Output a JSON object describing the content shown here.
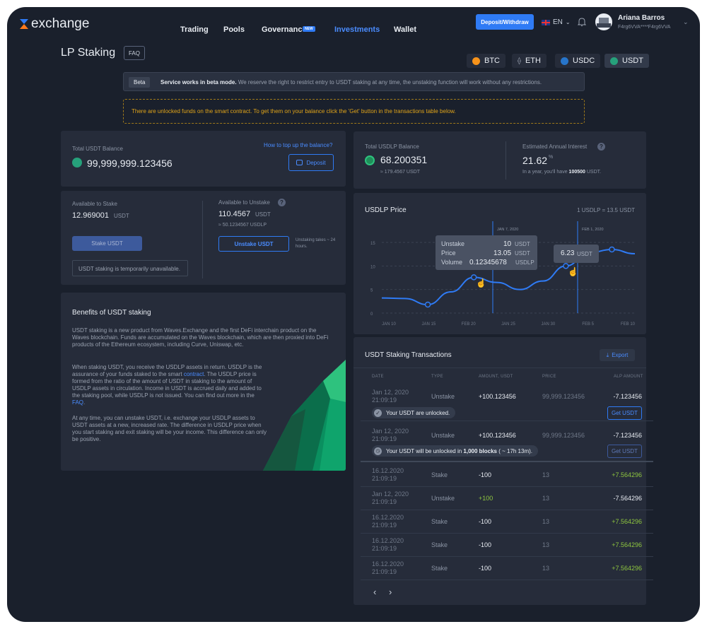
{
  "header": {
    "logo_text": "exchange",
    "nav": [
      "Trading",
      "Pools",
      "Governance",
      "Investments",
      "Wallet"
    ],
    "new_badge": "NEW",
    "deposit_button": "Deposit/Withdraw",
    "lang": "EN",
    "user_name": "Ariana Barros",
    "user_address": "F4rg6VVA****F4rg6VVA",
    "accent": "#2f7bf5"
  },
  "page": {
    "title": "LP Staking",
    "faq": "FAQ",
    "coins": [
      "BTC",
      "ETH",
      "USDC",
      "USDT"
    ],
    "beta_badge": "Beta",
    "beta_bold": "Service works in beta mode.",
    "beta_text": " We reserve the right to restrict entry to USDT staking at any time, the unstaking function will work without any restrictions.",
    "warning": "There are unlocked funds on the smart contract. To get them on your balance click the 'Get' button in the transactions table below."
  },
  "balance": {
    "label": "Total USDT Balance",
    "value": "99,999,999.123456",
    "topup_link": "How to top up the balance?",
    "deposit_button": "Deposit"
  },
  "stake": {
    "available_label": "Available to Stake",
    "available_value": "12.969001",
    "available_unit": "USDT",
    "stake_button": "Stake USDT",
    "unavailable_note": "USDT staking is temporarily unavailable.",
    "unstake_label": "Available to Unstake",
    "unstake_value": "110.4567",
    "unstake_unit": "USDT",
    "unstake_sub": "≈ 50.1234567 USDLP",
    "unstake_button": "Unstake USDT",
    "unstake_note": "Unstaking takes ~ 24 hours."
  },
  "benefits": {
    "title": "Benefits of USDT staking",
    "p1": "USDT staking is a new product from Waves.Exchange and the first DeFi interchain product on the Waves blockchain. Funds are accumulated on the Waves blockchain, which are then proxied into DeFi products of the Ethereum ecosystem, including Curve, Uniswap, etc.",
    "p2a": "When staking USDT, you receive the USDLP assets in return. USDLP is the assurance of your funds staked to the smart ",
    "p2link": "contract",
    "p2b": ". The USDLP price is formed from the ratio of the amount of USDT in staking to the amount of USDLP assets in circulation. Income in USDT is accrued daily and added to the staking pool, while USDLP is not issued. You can find out more in the ",
    "p2faq": "FAQ",
    "p2end": ".",
    "p3": "At any time, you can unstake USDT, i.e. exchange your USDLP assets to USDT assets at a new, increased rate. The difference in USDLP price when you start staking and exit staking will be your income. This difference can only be positive."
  },
  "usdlp": {
    "label": "Total USDLP Balance",
    "value": "68.200351",
    "sub": "≈ 179.4567 USDT",
    "interest_label": "Estimated Annual Interest",
    "interest_value": "21.62",
    "interest_unit": "%",
    "year_prefix": "In a year, you'll have ",
    "year_value": "100500",
    "year_suffix": " USDT."
  },
  "chart_data": {
    "type": "line",
    "title": "USDLP Price",
    "rate": "1 USDLP = 13.5 USDT",
    "xticks": [
      "JAN 10",
      "JAN 15",
      "FEB 20",
      "JAN 25",
      "JAN 30",
      "FEB 5",
      "FEB 10"
    ],
    "yticks": [
      0,
      5,
      10,
      15
    ],
    "ylim": [
      0,
      18
    ],
    "series": [
      {
        "values": [
          3.2,
          3.1,
          1.8,
          4.5,
          7.6,
          6.5,
          5.0,
          6.8,
          10.0,
          12.8,
          13.5,
          12.6
        ]
      }
    ],
    "markers": [
      {
        "label": "JAN 7, 2020"
      },
      {
        "label": "FEB 1, 2020"
      }
    ],
    "tooltip1": {
      "unstake_label": "Unstake",
      "unstake_value": "10",
      "unstake_unit": "USDT",
      "price_label": "Price",
      "price_value": "13.05",
      "price_unit": "USDT",
      "volume_label": "Volume",
      "volume_value": "0.12345678",
      "volume_unit": "USDLP"
    },
    "tooltip2": {
      "value": "6.23",
      "unit": "USDT"
    },
    "line_color": "#2f7bf5"
  },
  "transactions": {
    "title": "USDT Staking Transactions",
    "export": "Export",
    "headers": [
      "DATE",
      "TYPE",
      "AMOUNT, USDT",
      "PRICE",
      "ALP AMOUNT"
    ],
    "unlock_rows": [
      {
        "date": "Jan 12, 2020",
        "time": "21:09:19",
        "type": "Unstake",
        "amount": "+100.123456",
        "price": "99,999.123456",
        "alp": "-7.123456",
        "note": "Your USDT are unlocked.",
        "button": "Get USDT"
      },
      {
        "date": "Jan 12, 2020",
        "time": "21:09:19",
        "type": "Unstake",
        "amount": "+100.123456",
        "price": "99,999.123456",
        "alp": "-7.123456",
        "note_pre": "Your USDT will be unlocked in ",
        "note_bold": "1,000 blocks",
        "note_post": " ( ~ 17h 13m).",
        "button": "Get USDT"
      }
    ],
    "rows": [
      {
        "date": "16.12.2020",
        "time": "21:09:19",
        "type": "Stake",
        "amount": "-100",
        "price": "13",
        "alp": "+7.564296"
      },
      {
        "date": "Jan 12, 2020",
        "time": "21:09:19",
        "type": "Unstake",
        "amount": "+100",
        "price": "13",
        "alp": "-7.564296"
      },
      {
        "date": "16.12.2020",
        "time": "21:09:19",
        "type": "Stake",
        "amount": "-100",
        "price": "13",
        "alp": "+7.564296"
      },
      {
        "date": "16.12.2020",
        "time": "21:09:19",
        "type": "Stake",
        "amount": "-100",
        "price": "13",
        "alp": "+7.564296"
      },
      {
        "date": "16.12.2020",
        "time": "21:09:19",
        "type": "Stake",
        "amount": "-100",
        "price": "13",
        "alp": "+7.564296"
      }
    ]
  }
}
